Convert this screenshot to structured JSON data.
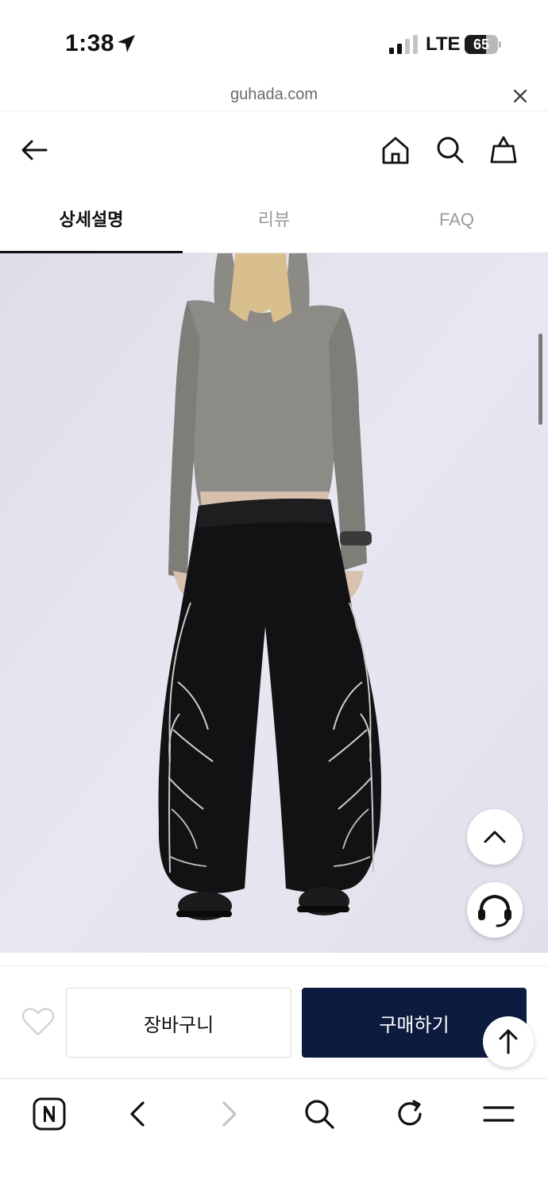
{
  "status_bar": {
    "time": "1:38",
    "network": "LTE",
    "battery_percent": "65",
    "battery_level": 0.65,
    "location_icon": "location-arrow-icon",
    "signal_icon": "cellular-signal-icon"
  },
  "browser": {
    "url": "guhada.com",
    "close_icon": "close-icon"
  },
  "header": {
    "back_icon": "back-arrow-icon",
    "home_icon": "home-icon",
    "search_icon": "search-icon",
    "cart_icon": "shopping-bag-icon"
  },
  "tabs": [
    {
      "label": "상세설명",
      "active": true
    },
    {
      "label": "리뷰",
      "active": false
    },
    {
      "label": "FAQ",
      "active": false
    }
  ],
  "floating": {
    "scroll_up_icon": "chevron-up-icon",
    "support_icon": "headset-icon"
  },
  "purchase_bar": {
    "wish_icon": "heart-icon",
    "cart_label": "장바구니",
    "buy_label": "구매하기",
    "scroll_top_icon": "arrow-up-icon"
  },
  "toolbar": {
    "items": [
      "naver-icon",
      "back-icon",
      "forward-icon",
      "search-icon",
      "refresh-icon",
      "menu-icon"
    ]
  },
  "colors": {
    "buy_button": "#0c1b3f",
    "active_tab": "#111111",
    "inactive_tab": "#9a9a9a",
    "image_background": "#e6e5ef"
  }
}
